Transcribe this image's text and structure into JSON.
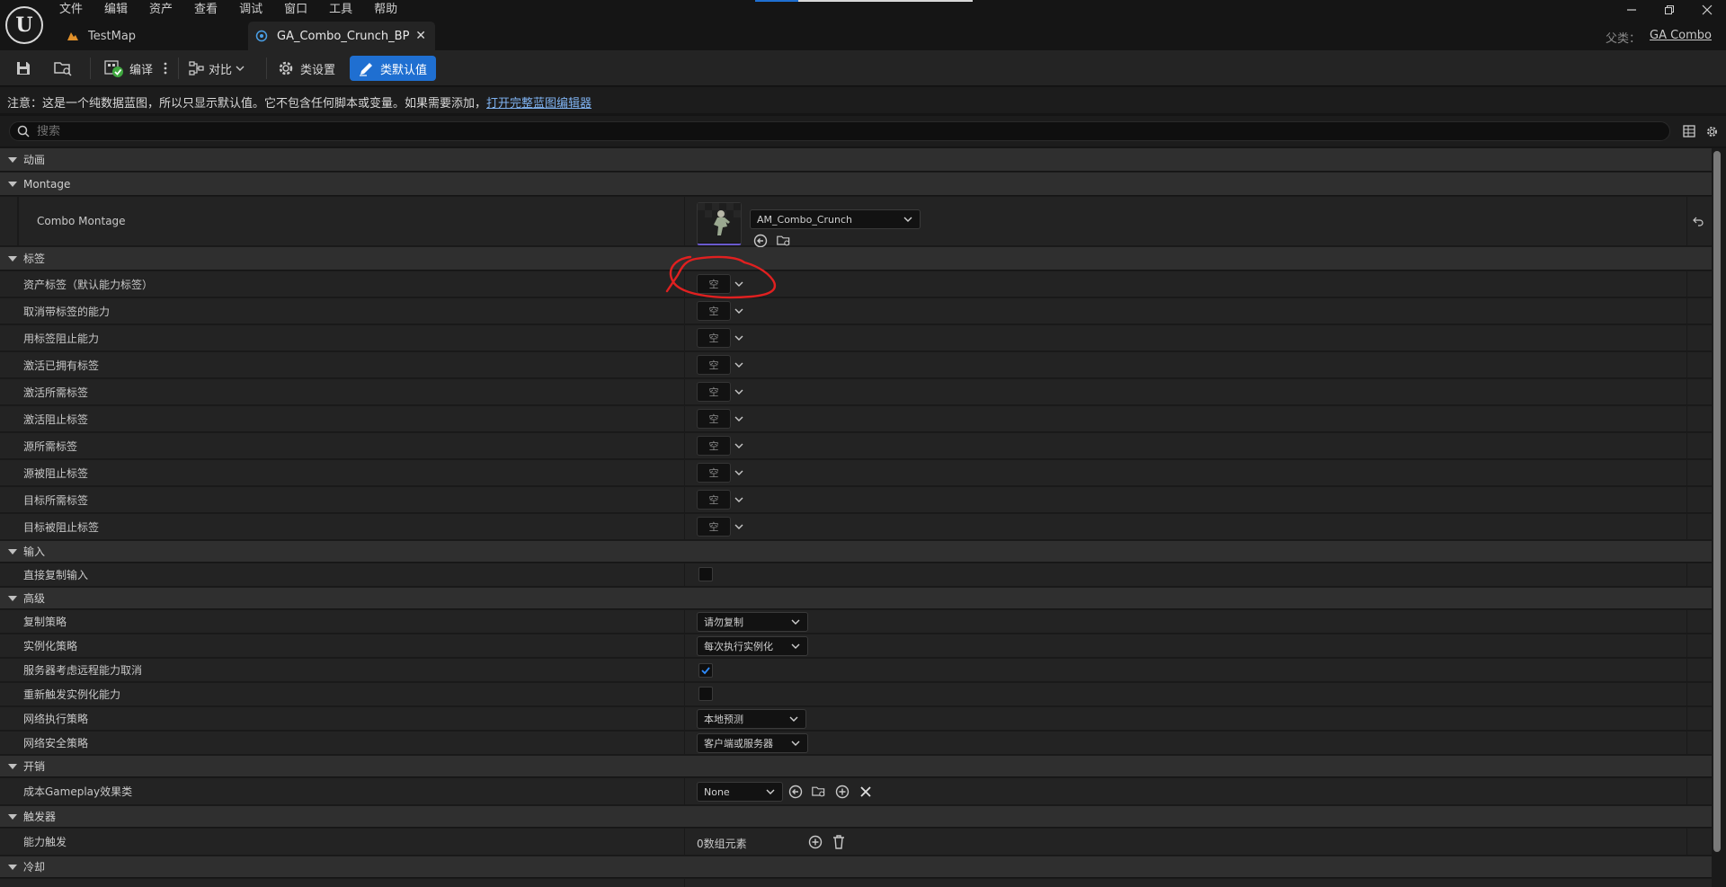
{
  "menu": [
    "文件",
    "编辑",
    "资产",
    "查看",
    "调试",
    "窗口",
    "工具",
    "帮助"
  ],
  "tabs": [
    {
      "label": "TestMap",
      "active": false
    },
    {
      "label": "GA_Combo_Crunch_BP",
      "active": true
    }
  ],
  "parent": {
    "label": "父类：",
    "value": "GA Combo"
  },
  "toolbar": {
    "compile": "编译",
    "diff": "对比",
    "class_settings": "类设置",
    "class_defaults": "类默认值"
  },
  "notice": {
    "text": "注意：这是一个纯数据蓝图，所以只显示默认值。它不包含任何脚本或变量。如果需要添加，",
    "link": "打开完整蓝图编辑器"
  },
  "search": {
    "placeholder": "搜索"
  },
  "categories": {
    "animation": "动画",
    "montage": "Montage",
    "tags": "标签",
    "input": "输入",
    "advanced": "高级",
    "costs": "开销",
    "triggers": "触发器",
    "cooldowns": "冷却"
  },
  "montage": {
    "label": "Combo Montage",
    "value": "AM_Combo_Crunch"
  },
  "tag_rows": [
    {
      "label": "资产标签（默认能力标签）",
      "value": "空"
    },
    {
      "label": "取消带标签的能力",
      "value": "空"
    },
    {
      "label": "用标签阻止能力",
      "value": "空"
    },
    {
      "label": "激活已拥有标签",
      "value": "空"
    },
    {
      "label": "激活所需标签",
      "value": "空"
    },
    {
      "label": "激活阻止标签",
      "value": "空"
    },
    {
      "label": "源所需标签",
      "value": "空"
    },
    {
      "label": "源被阻止标签",
      "value": "空"
    },
    {
      "label": "目标所需标签",
      "value": "空"
    },
    {
      "label": "目标被阻止标签",
      "value": "空"
    }
  ],
  "input": {
    "label": "直接复制输入",
    "checked": false
  },
  "advanced": {
    "replication": {
      "label": "复制策略",
      "value": "请勿复制"
    },
    "instancing": {
      "label": "实例化策略",
      "value": "每次执行实例化"
    },
    "server_respects": {
      "label": "服务器考虑远程能力取消",
      "checked": true
    },
    "retrigger": {
      "label": "重新触发实例化能力",
      "checked": false
    },
    "net_exec": {
      "label": "网络执行策略",
      "value": "本地预测"
    },
    "net_security": {
      "label": "网络安全策略",
      "value": "客户端或服务器"
    }
  },
  "costs": {
    "label": "成本Gameplay效果类",
    "value": "None"
  },
  "triggers": {
    "label": "能力触发",
    "value": "0数组元素"
  },
  "colors": {
    "accent": "#1f6fd1",
    "annotation": "#e02020",
    "panel": "#232323",
    "category": "#2f2f2f"
  }
}
